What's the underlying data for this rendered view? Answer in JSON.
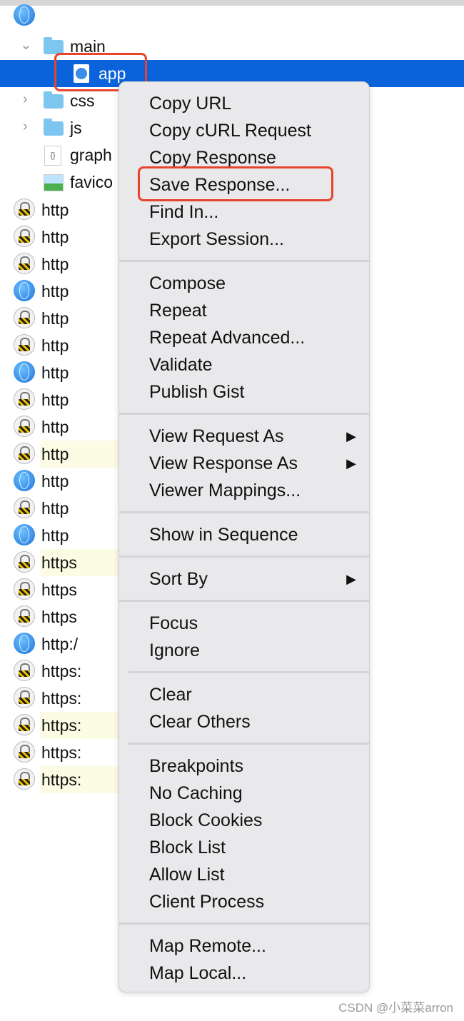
{
  "tree": {
    "main": "main",
    "app": "app",
    "css": "css",
    "js": "js",
    "graph": "graph",
    "favicon": "favico"
  },
  "rows": [
    {
      "icon": "lock",
      "text": "http",
      "hl": false
    },
    {
      "icon": "lock",
      "text": "http",
      "hl": false
    },
    {
      "icon": "lock",
      "text": "http",
      "hl": false
    },
    {
      "icon": "globe",
      "text": "http",
      "hl": false
    },
    {
      "icon": "lock",
      "text": "http",
      "hl": false
    },
    {
      "icon": "lock",
      "text": "http",
      "hl": false
    },
    {
      "icon": "globe",
      "text": "http",
      "hl": false
    },
    {
      "icon": "lock",
      "text": "http",
      "hl": false
    },
    {
      "icon": "lock",
      "text": "http",
      "hl": false
    },
    {
      "icon": "lock",
      "text": "http",
      "hl": true
    },
    {
      "icon": "globe",
      "text": "http",
      "hl": false
    },
    {
      "icon": "lock",
      "text": "http",
      "hl": false
    },
    {
      "icon": "globe",
      "text": "http",
      "hl": false
    },
    {
      "icon": "lock",
      "text": "https",
      "hl": true
    },
    {
      "icon": "lock",
      "text": "https",
      "hl": false
    },
    {
      "icon": "lock",
      "text": "https",
      "hl": false
    },
    {
      "icon": "globe",
      "text": "http:/",
      "hl": false
    },
    {
      "icon": "lock",
      "text": "https:",
      "hl": false
    },
    {
      "icon": "lock",
      "text": "https:",
      "hl": false
    },
    {
      "icon": "lock",
      "text": "https:",
      "hl": true
    },
    {
      "icon": "lock",
      "text": "https:",
      "hl": false
    },
    {
      "icon": "lock",
      "text": "https:",
      "hl": true
    }
  ],
  "menu": [
    [
      "Copy URL",
      "Copy cURL Request",
      "Copy Response",
      "Save Response...",
      "Find In...",
      "Export Session..."
    ],
    [
      "Compose",
      "Repeat",
      "Repeat Advanced...",
      "Validate",
      "Publish Gist"
    ],
    [
      "View Request As",
      "View Response As",
      "Viewer Mappings..."
    ],
    [
      "Show in Sequence"
    ],
    [
      "Sort By"
    ],
    [
      "Focus",
      "Ignore"
    ],
    [
      "Clear",
      "Clear Others"
    ],
    [
      "Breakpoints",
      "No Caching",
      "Block Cookies",
      "Block List",
      "Allow List",
      "Client Process"
    ],
    [
      "Map Remote...",
      "Map Local..."
    ]
  ],
  "submenu_items": [
    "View Request As",
    "View Response As",
    "Sort By"
  ],
  "watermark": "CSDN @小菜菜arron",
  "colors": {
    "selection": "#0b63db",
    "highlight_box": "#e8432d",
    "menu_bg": "#e9e9eb"
  }
}
